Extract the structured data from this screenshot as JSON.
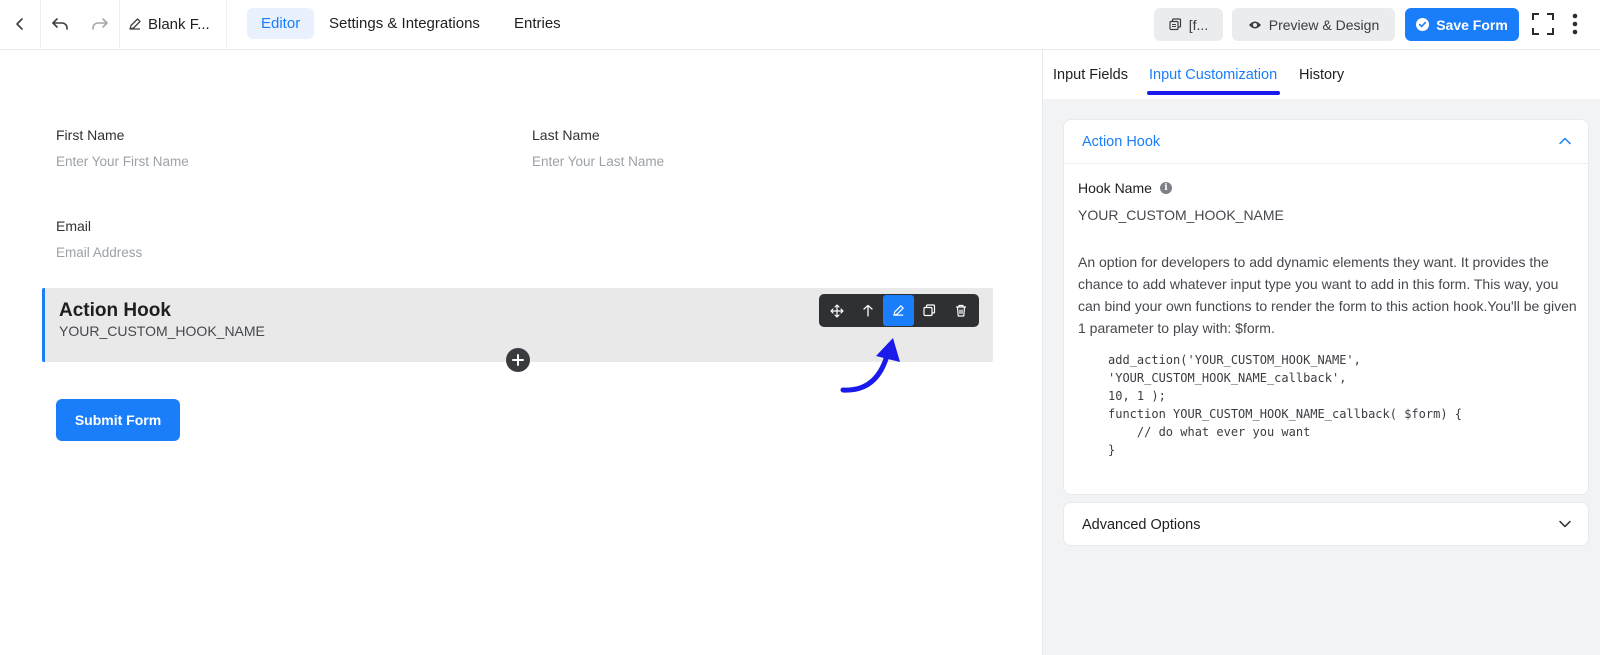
{
  "toolbar": {
    "form_title": "Blank F...",
    "tabs": [
      {
        "label": "Editor",
        "active": true
      },
      {
        "label": "Settings & Integrations",
        "active": false
      },
      {
        "label": "Entries",
        "active": false
      }
    ],
    "shortcode_label": "[f...",
    "preview_label": "Preview & Design",
    "save_label": "Save Form"
  },
  "form": {
    "first_name": {
      "label": "First Name",
      "placeholder": "Enter Your First Name"
    },
    "last_name": {
      "label": "Last Name",
      "placeholder": "Enter Your Last Name"
    },
    "email": {
      "label": "Email",
      "placeholder": "Email Address"
    },
    "action_hook": {
      "title": "Action Hook",
      "hook_name": "YOUR_CUSTOM_HOOK_NAME"
    },
    "submit_label": "Submit Form"
  },
  "panel": {
    "tabs": [
      {
        "label": "Input Fields",
        "active": false
      },
      {
        "label": "Input Customization",
        "active": true
      },
      {
        "label": "History",
        "active": false
      }
    ],
    "action_hook_card": {
      "title": "Action Hook",
      "hook_name_label": "Hook Name",
      "hook_name_value": "YOUR_CUSTOM_HOOK_NAME",
      "description": "An option for developers to add dynamic elements they want. It provides the chance to add whatever input type you want to add in this form. This way, you can bind your own functions to render the form to this action hook.You'll be given 1 parameter to play with: $form.",
      "code": [
        "add_action('YOUR_CUSTOM_HOOK_NAME',",
        "'YOUR_CUSTOM_HOOK_NAME_callback',",
        "10, 1 );",
        "function YOUR_CUSTOM_HOOK_NAME_callback( $form) {",
        "    // do what ever you want",
        "}"
      ]
    },
    "advanced_options_label": "Advanced Options"
  },
  "colors": {
    "accent": "#1a7efb",
    "annotation_arrow": "#1a1aea"
  }
}
